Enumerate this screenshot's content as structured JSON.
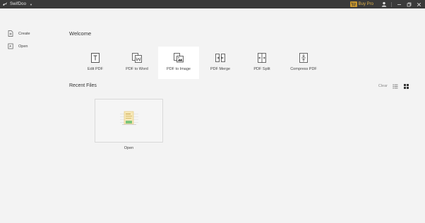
{
  "titlebar": {
    "app_name": "SwifDoo",
    "buy_pro_label": "Buy Pro"
  },
  "sidebar": {
    "items": [
      {
        "label": "Create",
        "icon": "create-icon"
      },
      {
        "label": "Open",
        "icon": "open-icon"
      }
    ]
  },
  "main": {
    "welcome": "Welcome",
    "tools": [
      {
        "label": "Edit PDF",
        "icon": "edit-pdf-icon"
      },
      {
        "label": "PDF to Word",
        "icon": "pdf-to-word-icon"
      },
      {
        "label": "PDF to Image",
        "icon": "pdf-to-image-icon"
      },
      {
        "label": "PDF Merge",
        "icon": "pdf-merge-icon"
      },
      {
        "label": "PDF Split",
        "icon": "pdf-split-icon"
      },
      {
        "label": "Compress PDF",
        "icon": "compress-pdf-icon"
      }
    ],
    "recent_title": "Recent Files",
    "clear_label": "Clear",
    "recent_files": [
      {
        "label": "Open"
      }
    ]
  },
  "colors": {
    "titlebar_bg": "#3a3a3a",
    "accent_gold": "#e2b34a",
    "background": "#f3f3f3"
  }
}
